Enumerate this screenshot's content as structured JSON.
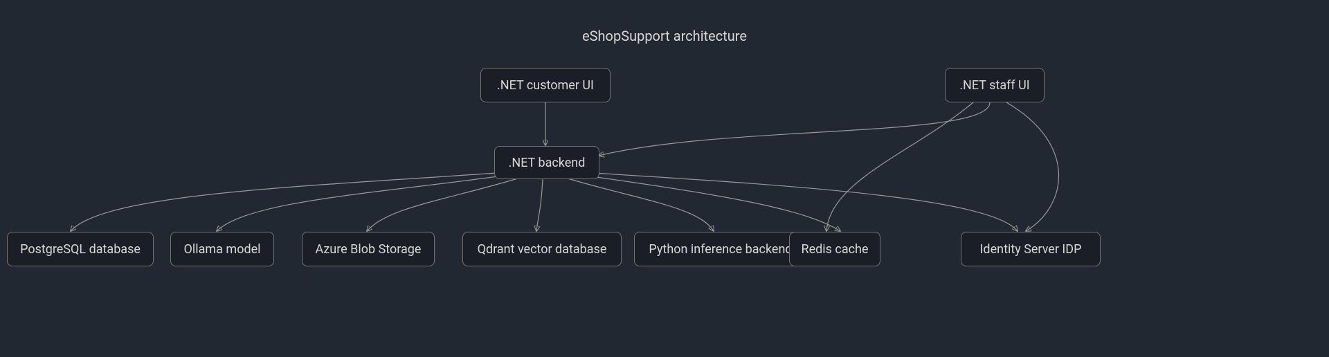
{
  "diagram": {
    "title": "eShopSupport architecture",
    "nodes": {
      "customer_ui": ".NET customer UI",
      "staff_ui": ".NET staff UI",
      "backend": ".NET backend",
      "postgres": "PostgreSQL database",
      "ollama": "Ollama model",
      "blob": "Azure Blob Storage",
      "qdrant": "Qdrant vector database",
      "python": "Python inference backend",
      "redis": "Redis cache",
      "idp": "Identity Server IDP"
    },
    "edges": [
      {
        "from": "customer_ui",
        "to": "backend"
      },
      {
        "from": "staff_ui",
        "to": "backend"
      },
      {
        "from": "staff_ui",
        "to": "redis"
      },
      {
        "from": "staff_ui",
        "to": "idp"
      },
      {
        "from": "backend",
        "to": "postgres"
      },
      {
        "from": "backend",
        "to": "ollama"
      },
      {
        "from": "backend",
        "to": "blob"
      },
      {
        "from": "backend",
        "to": "qdrant"
      },
      {
        "from": "backend",
        "to": "python"
      },
      {
        "from": "backend",
        "to": "redis"
      },
      {
        "from": "backend",
        "to": "idp"
      }
    ]
  }
}
